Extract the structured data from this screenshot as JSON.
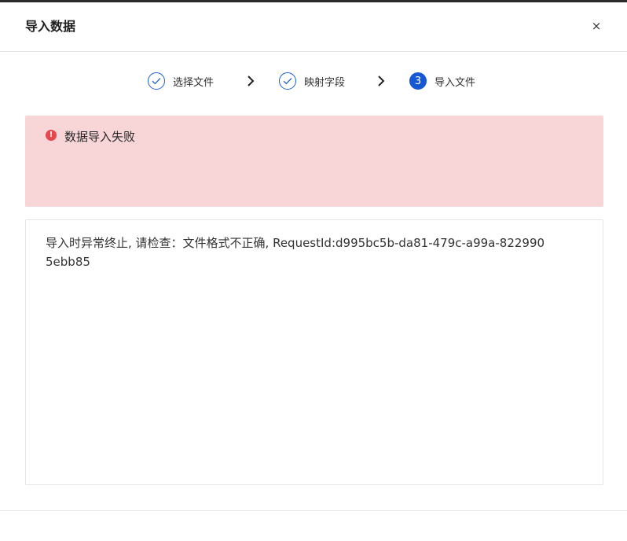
{
  "dialog": {
    "title": "导入数据",
    "close_label": "×"
  },
  "steps": [
    {
      "label": "选择文件",
      "status": "done",
      "icon": "check-icon"
    },
    {
      "label": "映射字段",
      "status": "done",
      "icon": "check-icon"
    },
    {
      "label": "导入文件",
      "status": "active",
      "number": "3"
    }
  ],
  "alert": {
    "text": "数据导入失败",
    "icon": "error-icon",
    "icon_glyph": "!",
    "background": "#f8d6d8",
    "icon_color": "#e5484d"
  },
  "message": {
    "text": "导入时异常终止, 请检查：文件格式不正确, RequestId:d995bc5b-da81-479c-a99a-8229905ebb85"
  },
  "colors": {
    "accent": "#1558d6"
  }
}
